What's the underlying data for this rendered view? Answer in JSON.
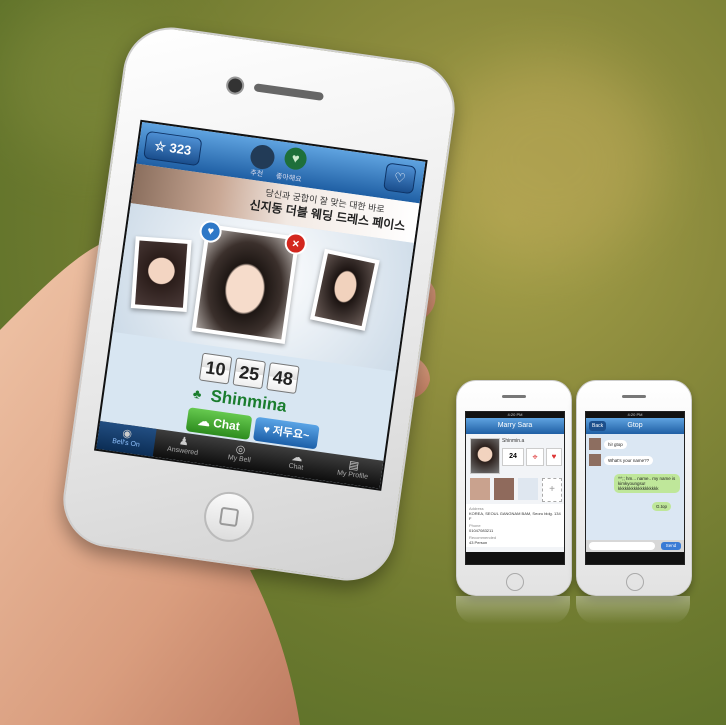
{
  "main_app": {
    "star_count": "323",
    "top_icons": {
      "left_label": "추천",
      "right_label": "좋아해요"
    },
    "banner": {
      "line1": "당신과 궁합이 잘 맞는 대한 바로",
      "line2": "신지동 더블 웨딩 드레스 페이스"
    },
    "timer": {
      "hours": "10",
      "minutes": "25",
      "seconds": "48"
    },
    "profile_name": "Shinmina",
    "chat_button": "Chat",
    "like_button": "저두요~",
    "tabs": [
      "Bell's On",
      "Answered",
      "My Bell",
      "Chat",
      "My Profile"
    ]
  },
  "small_phone_1": {
    "status_time": "4:20 PM",
    "nav_title": "Marry Sara",
    "profile_name": "Shinmin.a",
    "age": "24",
    "info_label": "Address",
    "address": "KOREA, SEOUL GANGNAM BAM, Seoru bldg. 134 F",
    "phone_label": "Phone",
    "phone": "01047083211",
    "recommended_label": "Recommended",
    "recommended": "43 Person"
  },
  "small_phone_2": {
    "status_time": "4:20 PM",
    "nav_title": "Gtop",
    "back_label": "Back",
    "messages": [
      {
        "from": "other",
        "text": "hi! gtop"
      },
      {
        "from": "other",
        "text": "What's your name??"
      },
      {
        "from": "me",
        "text": "^^;; hm... name.. my name is kimkyoungsu! kkkkkkkkkkkkkkkkkk"
      },
      {
        "from": "me",
        "text": "G.top"
      }
    ],
    "send_label": "Send"
  }
}
